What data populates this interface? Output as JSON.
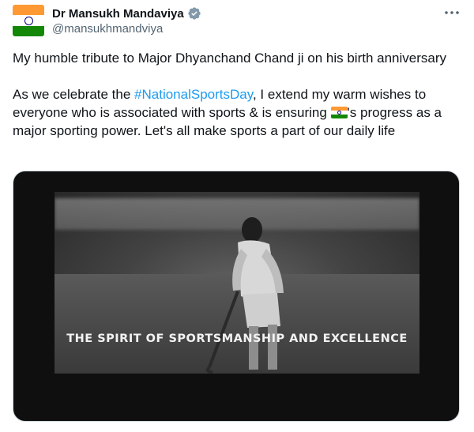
{
  "author": {
    "display_name": "Dr Mansukh Mandaviya",
    "handle": "@mansukhmandviya",
    "verified": true,
    "avatar_icon": "india-flag-icon"
  },
  "menu": {
    "icon": "more-options-icon"
  },
  "tweet": {
    "line1": "My humble tribute to Major Dhyanchand Chand ji on his birth anniversary",
    "line2_prefix": "As we celebrate the ",
    "hashtag": "#NationalSportsDay",
    "line2_mid": ", I extend my warm wishes to everyone who is associated with sports & is ensuring ",
    "flag_icon": "india-flag-emoji",
    "line2_suffix": "'s progress as a major sporting power. Let's all make sports a part of our daily life"
  },
  "media": {
    "caption": "THE SPIRIT OF SPORTSMANSHIP AND EXCELLENCE"
  },
  "colors": {
    "saffron": "#ff9933",
    "green": "#138808",
    "link": "#1d9bf0",
    "verified": "#829aab"
  }
}
